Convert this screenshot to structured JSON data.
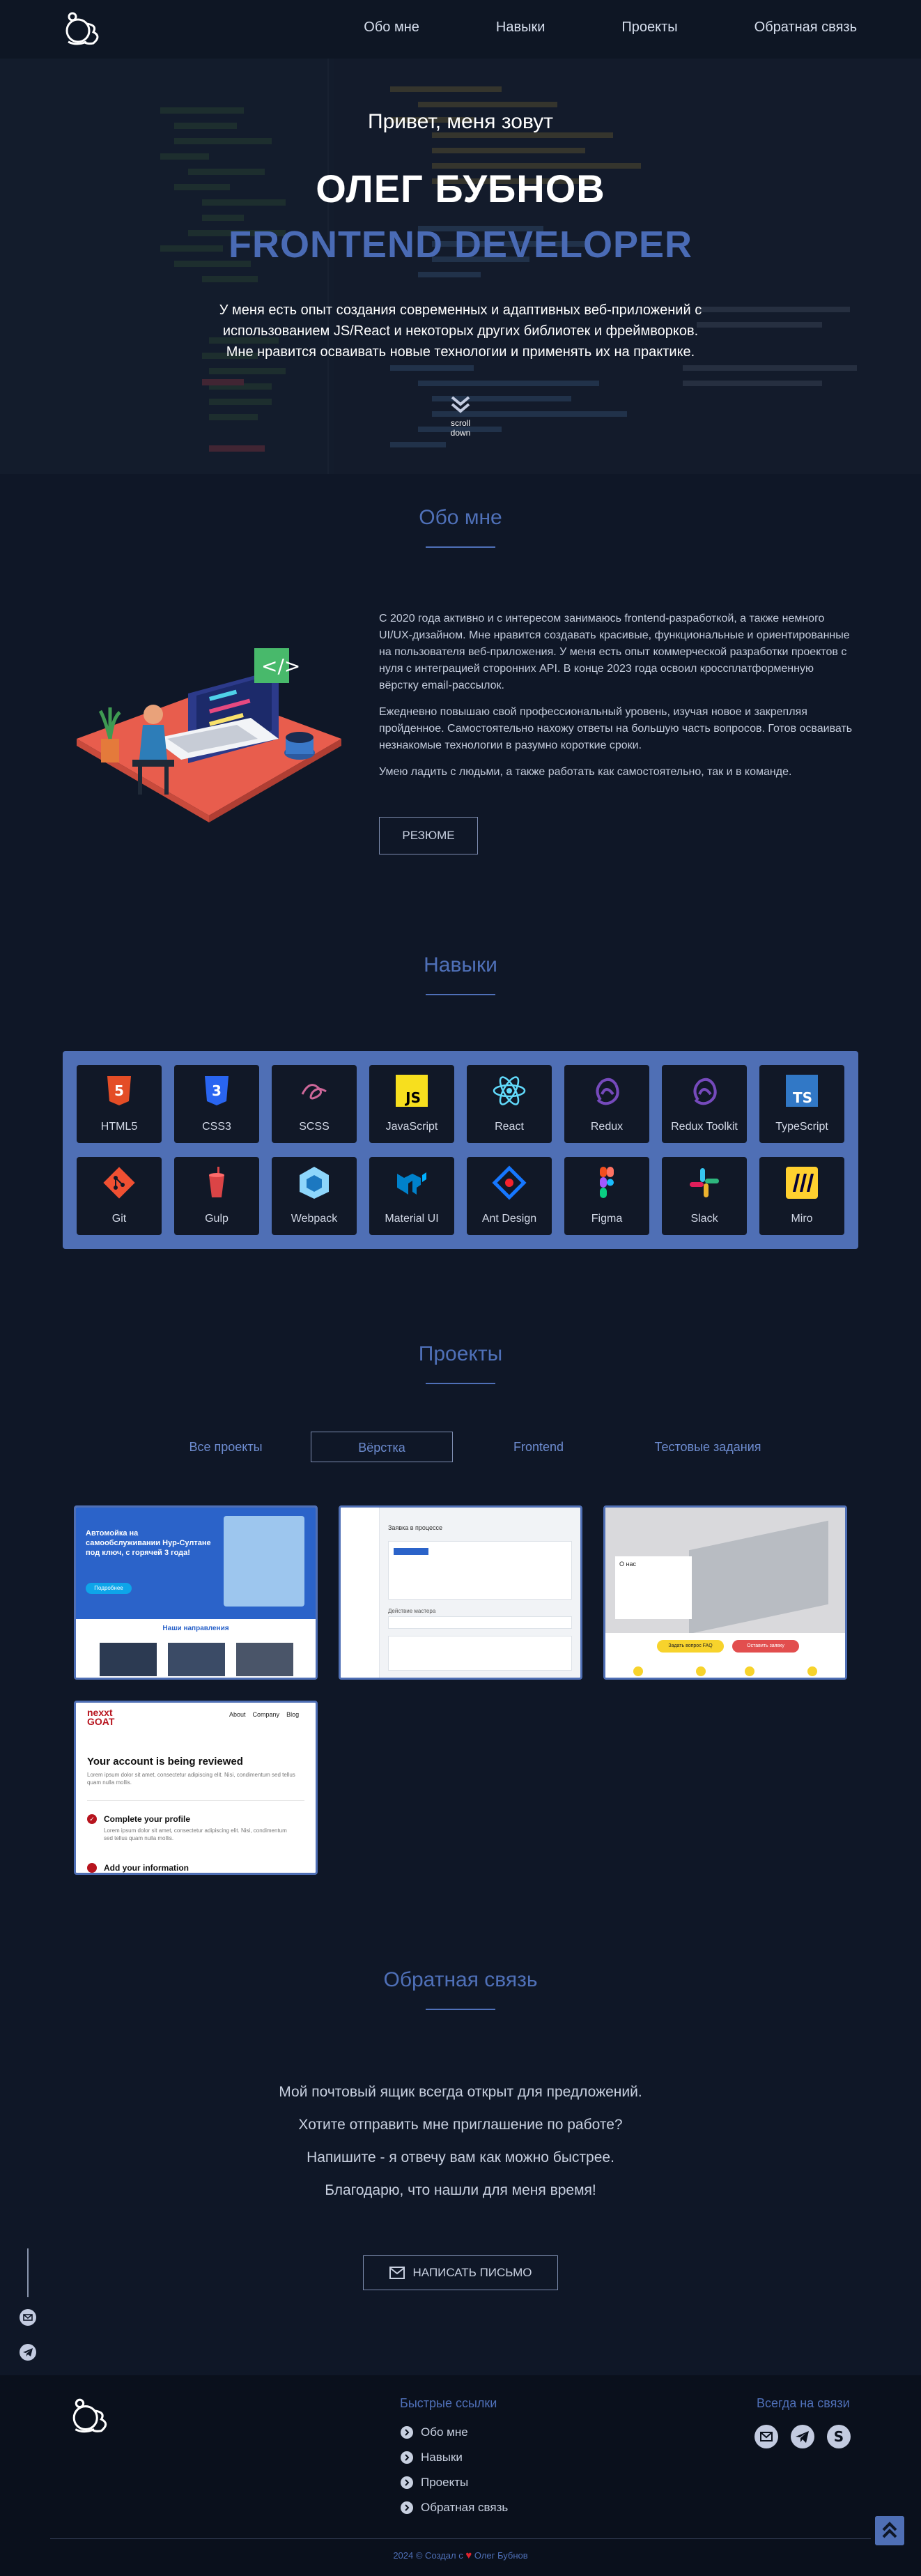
{
  "nav": {
    "items": [
      "Обо мне",
      "Навыки",
      "Проекты",
      "Обратная связь"
    ]
  },
  "hero": {
    "greeting": "Привет, меня зовут",
    "name": "ОЛЕГ БУБНОВ",
    "role": "FRONTEND DEVELOPER",
    "desc_lines": [
      "У меня есть опыт создания современных и адаптивных веб-приложений с",
      "использованием JS/React и некоторых других библиотек и фреймворков.",
      "Мне нравится осваивать новые технологии и применять их на практике."
    ],
    "scroll_label": "scroll down"
  },
  "about": {
    "title": "Обо мне",
    "paragraphs": [
      "С 2020 года активно и с интересом занимаюсь frontend-разработкой, а также немного UI/UX-дизайном. Мне нравится создавать красивые, функциональные и ориентированные на пользователя веб-приложения. У меня есть опыт коммерческой разработки проектов с нуля с интеграцией сторонних API. В конце 2023 года освоил кроссплатформенную вёрстку email-рассылок.",
      "Ежедневно повышаю свой профессиональный уровень, изучая новое и закрепляя пройденное. Самостоятельно нахожу ответы на большую часть вопросов. Готов осваивать незнакомые технологии в разумно короткие сроки.",
      "Умею ладить с людьми, а также работать как самостоятельно, так и в команде."
    ],
    "resume_label": "РЕЗЮМЕ"
  },
  "skills": {
    "title": "Навыки",
    "items": [
      {
        "label": "HTML5",
        "icon": "html5-icon"
      },
      {
        "label": "CSS3",
        "icon": "css3-icon"
      },
      {
        "label": "SCSS",
        "icon": "sass-icon"
      },
      {
        "label": "JavaScript",
        "icon": "javascript-icon"
      },
      {
        "label": "React",
        "icon": "react-icon"
      },
      {
        "label": "Redux",
        "icon": "redux-icon"
      },
      {
        "label": "Redux Toolkit",
        "icon": "redux-toolkit-icon"
      },
      {
        "label": "TypeScript",
        "icon": "typescript-icon"
      },
      {
        "label": "Git",
        "icon": "git-icon"
      },
      {
        "label": "Gulp",
        "icon": "gulp-icon"
      },
      {
        "label": "Webpack",
        "icon": "webpack-icon"
      },
      {
        "label": "Material UI",
        "icon": "material-ui-icon"
      },
      {
        "label": "Ant Design",
        "icon": "ant-design-icon"
      },
      {
        "label": "Figma",
        "icon": "figma-icon"
      },
      {
        "label": "Slack",
        "icon": "slack-icon"
      },
      {
        "label": "Miro",
        "icon": "miro-icon"
      }
    ]
  },
  "projects": {
    "title": "Проекты",
    "tabs": [
      "Все проекты",
      "Вёрстка",
      "Frontend",
      "Тестовые задания"
    ],
    "active_tab": "Вёрстка",
    "cards": [
      {
        "heading": "Автомойка на самообслуживании Нур-Султане под ключ, с горячей 3 года!",
        "sub": "Наши направления",
        "button": "Подробнее"
      },
      {
        "heading": "Заявка в процессе",
        "sub": "Действие мастера"
      },
      {
        "heading": "О нас",
        "button_a": "Задать вопрос FAQ",
        "button_b": "Оставить заявку"
      },
      {
        "brand_top": "nexxt",
        "brand_bottom": "GOAT",
        "nav": [
          "About",
          "Company",
          "Blog"
        ],
        "heading": "Your account is being reviewed",
        "body": "Lorem ipsum dolor sit amet, consectetur adipiscing elit. Nisi, condimentum sed tellus quam nulla mollis.",
        "step1_title": "Complete your profile",
        "step1_body": "Lorem ipsum dolor sit amet, consectetur adipiscing elit. Nisi, condimentum sed tellus quam nulla mollis.",
        "step2_title": "Add your information"
      }
    ]
  },
  "contact": {
    "title": "Обратная связь",
    "lines": [
      "Мой почтовый ящик всегда открыт для предложений.",
      "Хотите отправить мне приглашение по работе?",
      "Напишите - я отвечу вам как можно быстрее.",
      "Благодарю, что нашли для меня время!"
    ],
    "button_label": "НАПИСАТЬ ПИСЬМО"
  },
  "footer": {
    "links_title": "Быстрые ссылки",
    "links": [
      "Обо мне",
      "Навыки",
      "Проекты",
      "Обратная связь"
    ],
    "social_title": "Всегда на связи",
    "copyright_prefix": "2024 © Создал с",
    "copyright_name": "Олег Бубнов"
  },
  "colors": {
    "accent": "#4f6fb5",
    "background": "#0f1727",
    "footer": "#0a101c"
  }
}
